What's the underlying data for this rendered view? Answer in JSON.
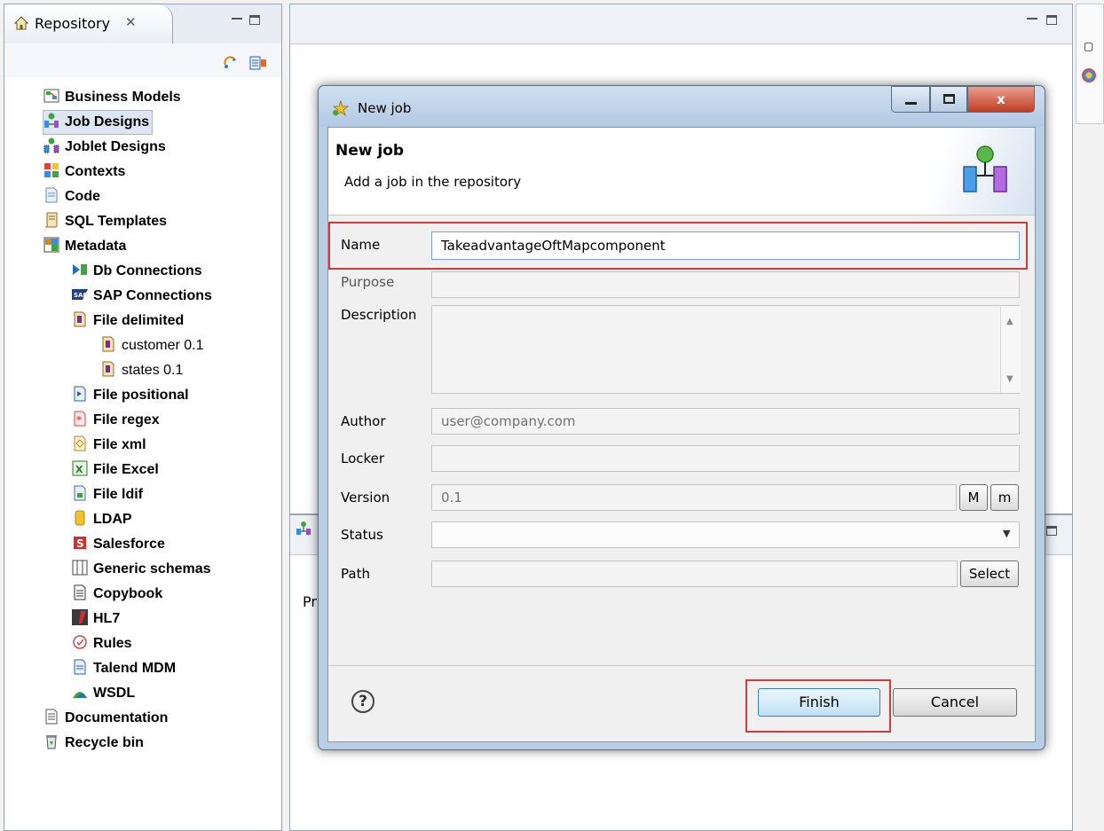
{
  "repository": {
    "tab_label": "Repository",
    "tab_close": "✕",
    "tree": [
      {
        "label": "Business Models",
        "icon": "business-models-icon",
        "level": 0,
        "bold": true
      },
      {
        "label": "Job Designs",
        "icon": "job-designs-icon",
        "level": 0,
        "bold": true,
        "selected": true
      },
      {
        "label": "Joblet Designs",
        "icon": "joblet-designs-icon",
        "level": 0,
        "bold": true
      },
      {
        "label": "Contexts",
        "icon": "contexts-icon",
        "level": 0,
        "bold": true
      },
      {
        "label": "Code",
        "icon": "code-icon",
        "level": 0,
        "bold": true
      },
      {
        "label": "SQL Templates",
        "icon": "sql-templates-icon",
        "level": 0,
        "bold": true
      },
      {
        "label": "Metadata",
        "icon": "metadata-icon",
        "level": 0,
        "bold": true
      },
      {
        "label": "Db Connections",
        "icon": "db-connections-icon",
        "level": 1,
        "bold": true
      },
      {
        "label": "SAP Connections",
        "icon": "sap-connections-icon",
        "level": 1,
        "bold": true
      },
      {
        "label": "File delimited",
        "icon": "file-delimited-icon",
        "level": 1,
        "bold": true
      },
      {
        "label": "customer 0.1",
        "icon": "file-delimited-icon",
        "level": 2,
        "bold": false
      },
      {
        "label": "states 0.1",
        "icon": "file-delimited-icon",
        "level": 2,
        "bold": false
      },
      {
        "label": "File positional",
        "icon": "file-positional-icon",
        "level": 1,
        "bold": true
      },
      {
        "label": "File regex",
        "icon": "file-regex-icon",
        "level": 1,
        "bold": true
      },
      {
        "label": "File xml",
        "icon": "file-xml-icon",
        "level": 1,
        "bold": true
      },
      {
        "label": "File Excel",
        "icon": "file-excel-icon",
        "level": 1,
        "bold": true
      },
      {
        "label": "File ldif",
        "icon": "file-ldif-icon",
        "level": 1,
        "bold": true
      },
      {
        "label": "LDAP",
        "icon": "ldap-icon",
        "level": 1,
        "bold": true
      },
      {
        "label": "Salesforce",
        "icon": "salesforce-icon",
        "level": 1,
        "bold": true
      },
      {
        "label": "Generic schemas",
        "icon": "generic-schemas-icon",
        "level": 1,
        "bold": true
      },
      {
        "label": "Copybook",
        "icon": "copybook-icon",
        "level": 1,
        "bold": true
      },
      {
        "label": "HL7",
        "icon": "hl7-icon",
        "level": 1,
        "bold": true
      },
      {
        "label": "Rules",
        "icon": "rules-icon",
        "level": 1,
        "bold": true
      },
      {
        "label": "Talend MDM",
        "icon": "talend-mdm-icon",
        "level": 1,
        "bold": true
      },
      {
        "label": "WSDL",
        "icon": "wsdl-icon",
        "level": 1,
        "bold": true
      },
      {
        "label": "Documentation",
        "icon": "documentation-icon",
        "level": 0,
        "bold": true
      },
      {
        "label": "Recycle bin",
        "icon": "recycle-bin-icon",
        "level": 0,
        "bold": true
      }
    ]
  },
  "bottom_panel": {
    "partial_text": "Pr"
  },
  "dialog": {
    "window_title": "New job",
    "close_glyph": "x",
    "header_title": "New job",
    "header_description": "Add a job in the repository",
    "labels": {
      "name": "Name",
      "purpose": "Purpose",
      "description": "Description",
      "author": "Author",
      "locker": "Locker",
      "version": "Version",
      "status": "Status",
      "path": "Path"
    },
    "values": {
      "name": "TakeadvantageOftMapcomponent",
      "purpose": "",
      "description": "",
      "author": "user@company.com",
      "locker": "",
      "version": "0.1",
      "status": "",
      "path": ""
    },
    "buttons": {
      "major_version": "M",
      "minor_version": "m",
      "select": "Select",
      "finish": "Finish",
      "cancel": "Cancel",
      "help": "?"
    }
  },
  "colors": {
    "highlight": "#d23b3b",
    "selection": "#dde6f2",
    "dialog_frame": "#b9cde3"
  }
}
